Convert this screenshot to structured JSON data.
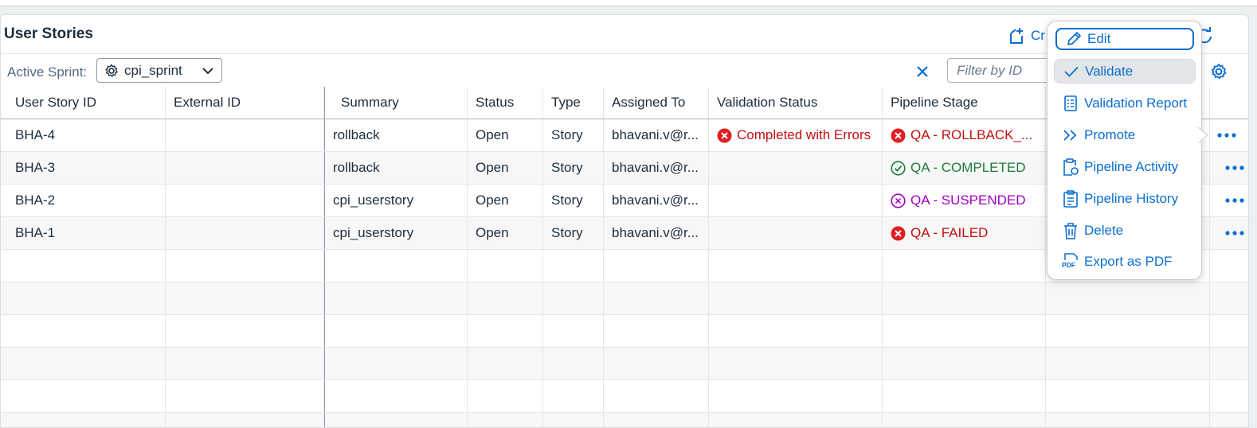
{
  "page": {
    "title": "User Stories"
  },
  "toolbar": {
    "create_label": "Cr"
  },
  "filter": {
    "sprint_label": "Active Sprint:",
    "sprint_value": "cpi_sprint",
    "filter_placeholder": "Filter by ID"
  },
  "table": {
    "columns": [
      "User Story ID",
      "External ID",
      "Summary",
      "Status",
      "Type",
      "Assigned To",
      "Validation Status",
      "Pipeline Stage"
    ],
    "rows": [
      {
        "id": "BHA-4",
        "external_id": "",
        "summary": "rollback",
        "status": "Open",
        "type": "Story",
        "assigned": "bhavani.v@r...",
        "validation": "Completed with Errors",
        "validation_state": "error",
        "stage": "QA - ROLLBACK_...",
        "stage_state": "error"
      },
      {
        "id": "BHA-3",
        "external_id": "",
        "summary": "rollback",
        "status": "Open",
        "type": "Story",
        "assigned": "bhavani.v@r...",
        "validation": "",
        "validation_state": "none",
        "stage": "QA - COMPLETED",
        "stage_state": "success"
      },
      {
        "id": "BHA-2",
        "external_id": "",
        "summary": "cpi_userstory",
        "status": "Open",
        "type": "Story",
        "assigned": "bhavani.v@r...",
        "validation": "",
        "validation_state": "none",
        "stage": "QA - SUSPENDED",
        "stage_state": "suspended"
      },
      {
        "id": "BHA-1",
        "external_id": "",
        "summary": "cpi_userstory",
        "status": "Open",
        "type": "Story",
        "assigned": "bhavani.v@r...",
        "validation": "",
        "validation_state": "none",
        "stage": "QA - FAILED",
        "stage_state": "error"
      }
    ]
  },
  "menu": {
    "items": [
      {
        "label": "Edit",
        "icon": "pencil-icon"
      },
      {
        "label": "Validate",
        "icon": "checkmark-icon"
      },
      {
        "label": "Validation Report",
        "icon": "report-icon"
      },
      {
        "label": "Promote",
        "icon": "double-chevron-right-icon"
      },
      {
        "label": "Pipeline Activity",
        "icon": "clipboard-activity-icon"
      },
      {
        "label": "Pipeline History",
        "icon": "clipboard-history-icon"
      },
      {
        "label": "Delete",
        "icon": "trash-icon"
      },
      {
        "label": "Export as PDF",
        "icon": "pdf-icon"
      }
    ]
  },
  "colors": {
    "accent": "#0a6ed1",
    "error": "#c0110e",
    "success": "#1d7a3a",
    "suspended": "#a100c2"
  }
}
